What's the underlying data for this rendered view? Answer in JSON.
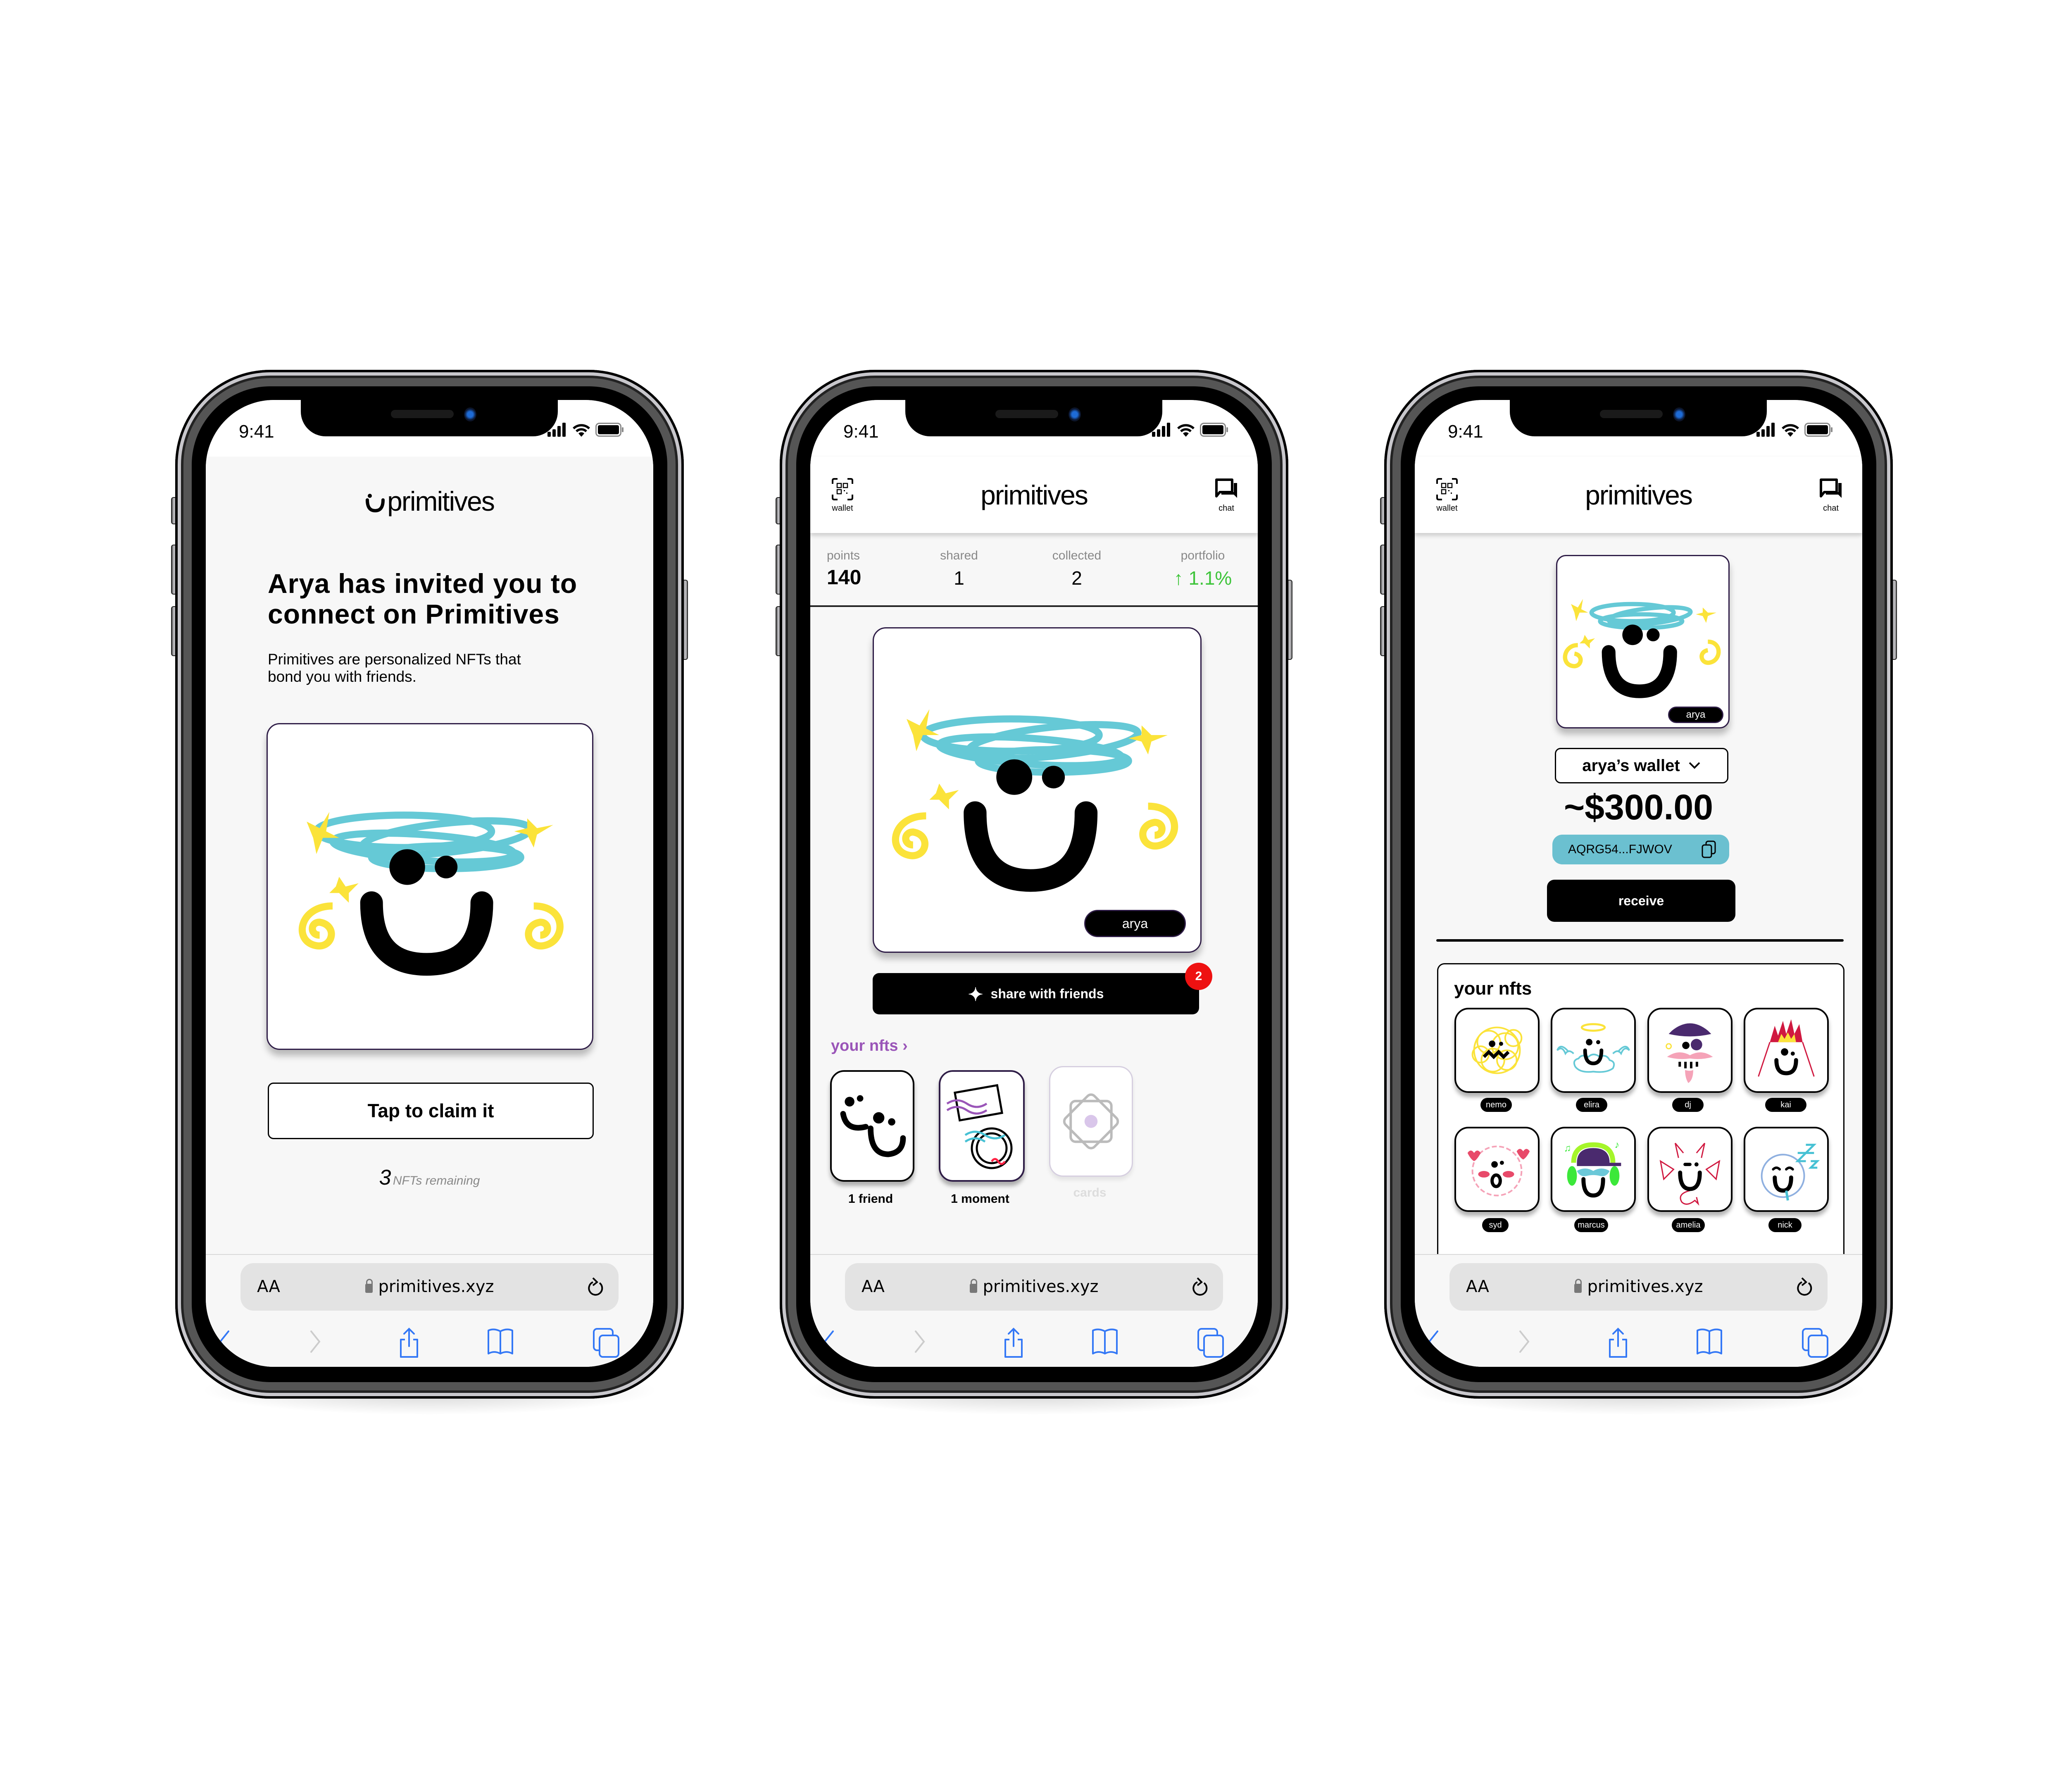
{
  "status_bar": {
    "time": "9:41"
  },
  "browser": {
    "text_size_label": "AA",
    "url": "primitives.xyz"
  },
  "screen1": {
    "logo": "primitives",
    "heading_line1": "Arya has invited you to",
    "heading_line2": "connect on Primitives",
    "description_line1": "Primitives are personalized NFTs that",
    "description_line2": "bond you with friends.",
    "claim_button": "Tap to claim it",
    "remaining_count": "3",
    "remaining_label": "NFTs remaining"
  },
  "screen2": {
    "header": {
      "logo": "primitives",
      "wallet_label": "wallet",
      "chat_label": "chat"
    },
    "stats": [
      {
        "label": "points",
        "value": "140"
      },
      {
        "label": "shared",
        "value": "1"
      },
      {
        "label": "collected",
        "value": "2"
      },
      {
        "label": "portfolio",
        "value": "1.1%",
        "trend": "up"
      }
    ],
    "card_owner": "arya",
    "share_button": "share with friends",
    "share_badge": "2",
    "your_nfts_link": "your nfts ›",
    "categories": [
      {
        "label": "1 friend",
        "enabled": true
      },
      {
        "label": "1 moment",
        "enabled": true
      },
      {
        "label": "cards",
        "enabled": false
      }
    ]
  },
  "screen3": {
    "header": {
      "logo": "primitives",
      "wallet_label": "wallet",
      "chat_label": "chat"
    },
    "card_owner": "arya",
    "wallet_selector": "arya’s wallet",
    "balance": "~$300.00",
    "address": "AQRG54...FJWOV",
    "receive_button": "receive",
    "your_nfts_title": "your nfts",
    "nfts": [
      {
        "name": "nemo"
      },
      {
        "name": "elira"
      },
      {
        "name": "dj"
      },
      {
        "name": "kai"
      },
      {
        "name": "syd"
      },
      {
        "name": "marcus"
      },
      {
        "name": "amelia"
      },
      {
        "name": "nick"
      }
    ]
  },
  "colors": {
    "accent_purple": "#9a55b8",
    "portfolio_green": "#3ec43a",
    "badge_red": "#ee1111",
    "address_pill": "#6bc0d0",
    "ios_blue": "#3478f6",
    "card_border": "#2f1d47"
  }
}
